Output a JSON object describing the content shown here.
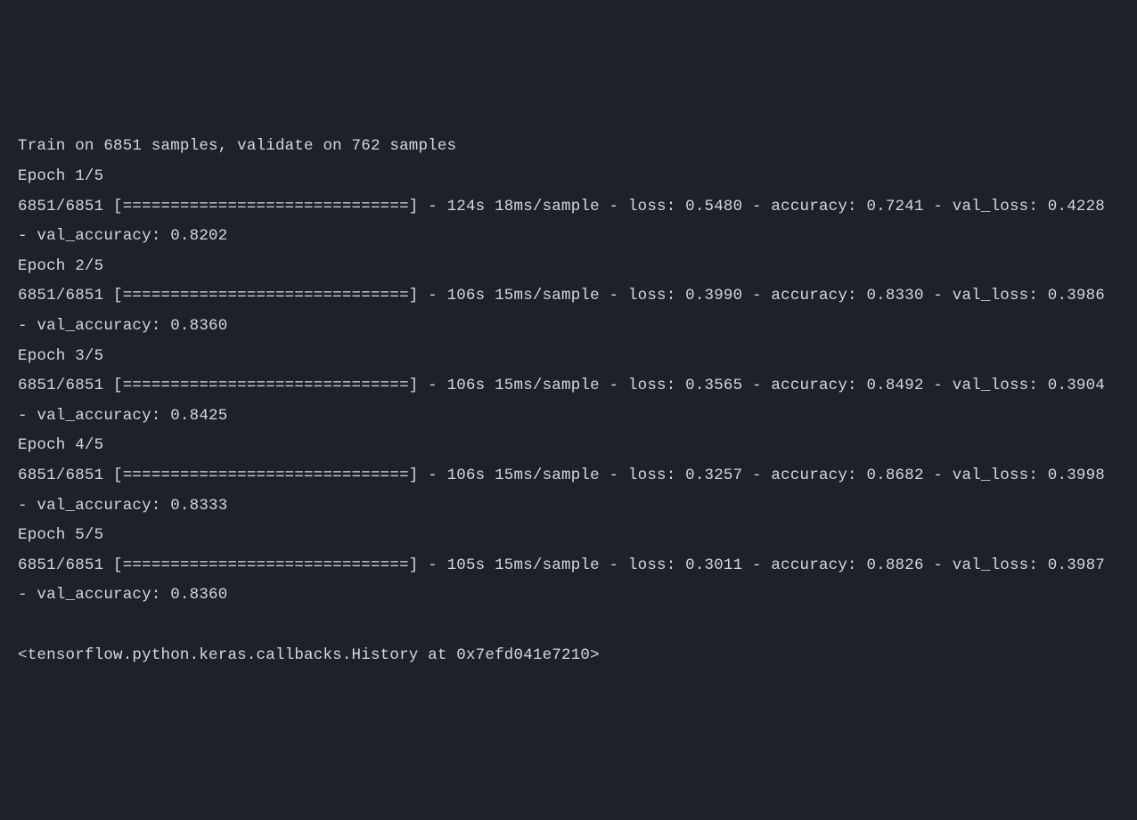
{
  "training": {
    "header": "Train on 6851 samples, validate on 762 samples",
    "epochs": [
      {
        "label": "Epoch 1/5",
        "progress": "6851/6851 [==============================] - 124s 18ms/sample - loss: 0.5480 - accuracy: 0.7241 - val_loss: 0.4228 - val_accuracy: 0.8202"
      },
      {
        "label": "Epoch 2/5",
        "progress": "6851/6851 [==============================] - 106s 15ms/sample - loss: 0.3990 - accuracy: 0.8330 - val_loss: 0.3986 - val_accuracy: 0.8360"
      },
      {
        "label": "Epoch 3/5",
        "progress": "6851/6851 [==============================] - 106s 15ms/sample - loss: 0.3565 - accuracy: 0.8492 - val_loss: 0.3904 - val_accuracy: 0.8425"
      },
      {
        "label": "Epoch 4/5",
        "progress": "6851/6851 [==============================] - 106s 15ms/sample - loss: 0.3257 - accuracy: 0.8682 - val_loss: 0.3998 - val_accuracy: 0.8333"
      },
      {
        "label": "Epoch 5/5",
        "progress": "6851/6851 [==============================] - 105s 15ms/sample - loss: 0.3011 - accuracy: 0.8826 - val_loss: 0.3987 - val_accuracy: 0.8360"
      }
    ],
    "return_value": "<tensorflow.python.keras.callbacks.History at 0x7efd041e7210>"
  }
}
